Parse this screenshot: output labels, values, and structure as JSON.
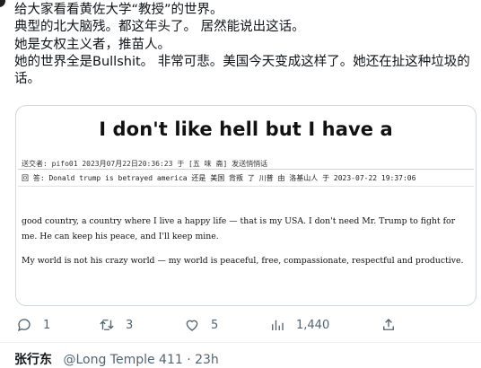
{
  "tweet": {
    "lines": [
      "给大家看看黄佐大学“教授”的世界。",
      "典型的北大脑残。都这年头了。 居然能说出这话。",
      "她是女权主义者，推苗人。",
      "她的世界全是Bullshit。 非常可悲。美国今天变成这样了。她还在扯这种垃圾的话。"
    ]
  },
  "embed": {
    "title": "I don't like hell but I have a",
    "meta": "送交者: pifo01 2023月07月22日20:36:23 于 [五 味 斋] 发送悄悄话",
    "reply": "回  答: Donald trump is betrayed america 还是 美国 背叛 了 川普 由 洛基山人 于 2023-07-22 19:37:06",
    "paragraphs": [
      "good country, a country where I live a happy life — that is my USA. I don't need Mr. Trump to fight for me. He can keep his peace, and I'll keep mine.",
      "My world is not his crazy world — my world is peaceful, free, compassionate, respectful and productive."
    ]
  },
  "actions": {
    "reply_count": "1",
    "retweet_count": "3",
    "like_count": "5",
    "views_count": "1,440"
  },
  "next_row": {
    "name": "张行东",
    "handle": "@Long Temple 411 · 23h"
  }
}
